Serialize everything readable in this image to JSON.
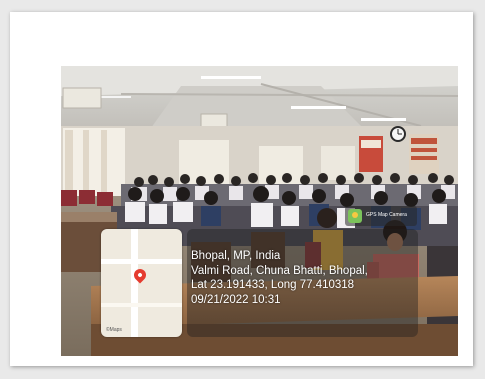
{
  "photo": {
    "description_alt": "Seminar hall with seated students"
  },
  "map": {
    "attribution": "©Maps"
  },
  "badge": {
    "label": "GPS Map Camera"
  },
  "location": {
    "line1": "Bhopal, MP, India",
    "line2": "Valmi Road, Chuna Bhatti, Bhopal,",
    "line3": "Lat 23.191433, Long 77.410318",
    "line4": "09/21/2022 10:31"
  }
}
